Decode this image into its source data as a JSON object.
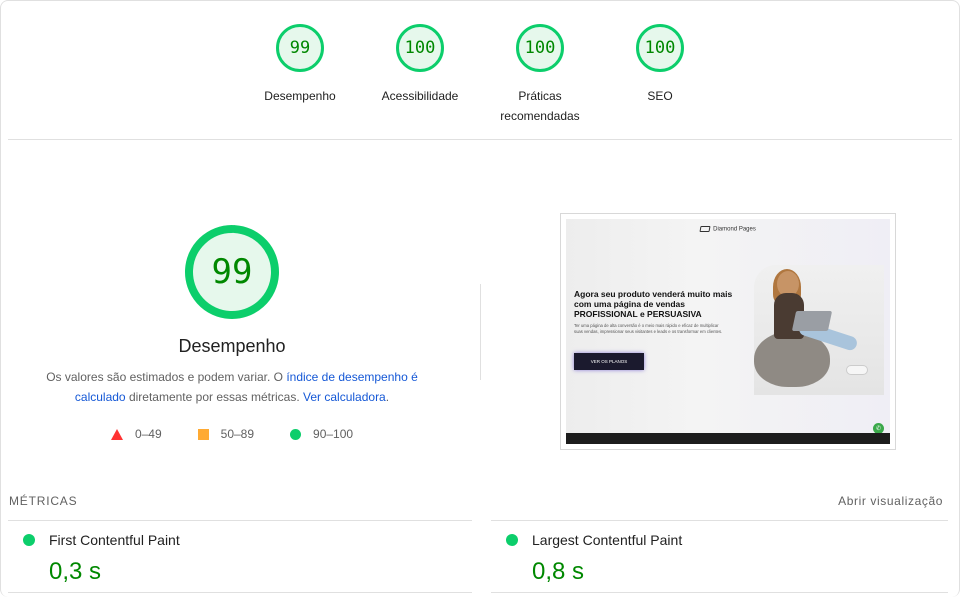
{
  "top_gauges": [
    {
      "score": "99",
      "label": "Desempenho"
    },
    {
      "score": "100",
      "label": "Acessibilidade"
    },
    {
      "score": "100",
      "label": "Práticas recomendadas"
    },
    {
      "score": "100",
      "label": "SEO"
    }
  ],
  "performance": {
    "score": "99",
    "score_fraction": 0.99,
    "title": "Desempenho",
    "desc_prefix": "Os valores são estimados e podem variar. O ",
    "desc_link1": "índice de desempenho é calculado",
    "desc_middle": " diretamente por essas métricas. ",
    "desc_link2": "Ver calculadora",
    "desc_suffix": ".",
    "legend": [
      {
        "range": "0–49",
        "color": "#ff3333"
      },
      {
        "range": "50–89",
        "color": "#ffaa33"
      },
      {
        "range": "90–100",
        "color": "#0cce6b"
      }
    ]
  },
  "screenshot": {
    "brand": "Diamond Pages",
    "headline_1": "Agora seu produto venderá muito mais com uma página de vendas",
    "headline_2": "PROFISSIONAL e PERSUASIVA",
    "subtext": "Ter uma página de alta conversão é o meio mais rápido e eficaz de multiplicar suas vendas, impressionar seus visitantes e leads e os transformar em clientes.",
    "button": "VER OS PLANOS"
  },
  "metrics": {
    "label": "MÉTRICAS",
    "expand": "Abrir visualização",
    "items": [
      {
        "name": "First Contentful Paint",
        "value": "0,3 s"
      },
      {
        "name": "Largest Contentful Paint",
        "value": "0,8 s"
      }
    ]
  },
  "colors": {
    "pass": "#0cce6b",
    "pass_text": "#008800",
    "pass_bg": "#e6f8ec",
    "link": "#1558d6"
  }
}
